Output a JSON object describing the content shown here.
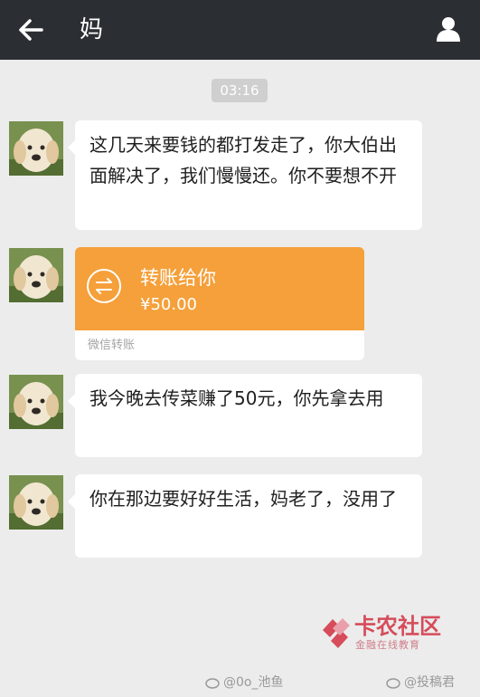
{
  "header": {
    "title": "妈"
  },
  "chat": {
    "timestamp": "03:16",
    "messages": [
      {
        "text": "这几天来要钱的都打发走了，你大伯出面解决了，我们慢慢还。你不要想不开"
      },
      {
        "text": "我今晚去传菜赚了50元，你先拿去用"
      },
      {
        "text": "你在那边要好好生活，妈老了，没用了"
      }
    ],
    "transfer": {
      "title": "转账给你",
      "amount": "¥50.00",
      "source": "微信转账"
    }
  },
  "watermark": {
    "title": "卡农社区",
    "subtitle": "金融在线教育"
  },
  "footer": {
    "credit_1": "@0o_池鱼",
    "credit_2": "@投稿君"
  },
  "icons": {
    "back": "arrow-left-icon",
    "profile": "person-icon",
    "transfer": "transfer-icon",
    "weibo": "weibo-icon"
  },
  "colors": {
    "top_bar": "#2b2f33",
    "background": "#ececec",
    "transfer": "#f5a03a",
    "watermark": "#d64c5a"
  }
}
